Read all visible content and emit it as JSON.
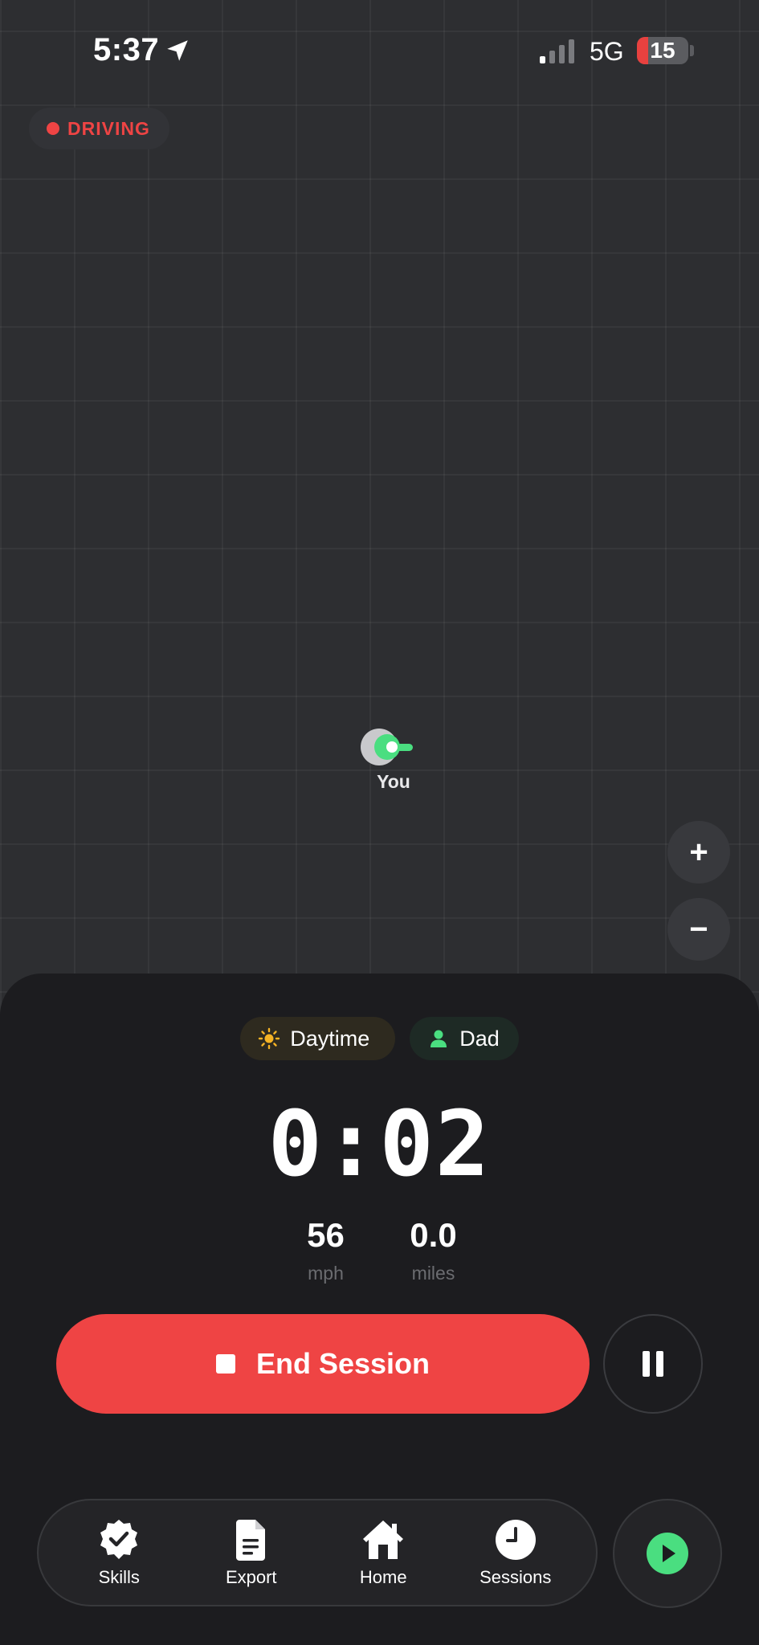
{
  "status_bar": {
    "time": "5:37",
    "network": "5G",
    "battery": "15"
  },
  "map": {
    "mode_badge": "DRIVING",
    "marker_label": "You",
    "zoom_in": "+",
    "zoom_out": "−"
  },
  "session": {
    "time_of_day": "Daytime",
    "supervisor": "Dad",
    "elapsed": "0:02",
    "speed_value": "56",
    "speed_unit": "mph",
    "distance_value": "0.0",
    "distance_unit": "miles",
    "end_label": "End Session"
  },
  "tabs": [
    {
      "label": "Skills",
      "icon": "badge-check-icon"
    },
    {
      "label": "Export",
      "icon": "document-icon"
    },
    {
      "label": "Home",
      "icon": "home-icon"
    },
    {
      "label": "Sessions",
      "icon": "clock-icon"
    }
  ],
  "colors": {
    "accent_red": "#ef4444",
    "accent_green": "#4ade80",
    "sheet_bg": "#1c1c1f"
  }
}
